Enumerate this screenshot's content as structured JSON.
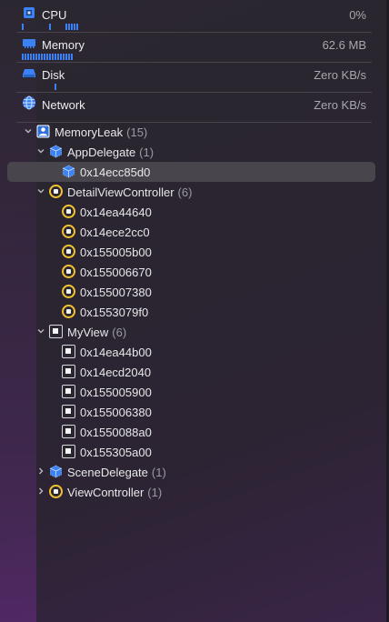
{
  "gauges": [
    {
      "label": "CPU",
      "value": "0%",
      "icon": "cpu-icon"
    },
    {
      "label": "Memory",
      "value": "62.6 MB",
      "icon": "memory-icon"
    },
    {
      "label": "Disk",
      "value": "Zero KB/s",
      "icon": "disk-icon"
    },
    {
      "label": "Network",
      "value": "Zero KB/s",
      "icon": "globe-icon"
    }
  ],
  "tree": {
    "root": {
      "label": "MemoryLeak",
      "count": "(15)"
    },
    "app_delegate": {
      "label": "AppDelegate",
      "count": "(1)",
      "instances": [
        "0x14ecc85d0"
      ]
    },
    "detail_vc": {
      "label": "DetailViewController",
      "count": "(6)",
      "instances": [
        "0x14ea44640",
        "0x14ece2cc0",
        "0x155005b00",
        "0x155006670",
        "0x155007380",
        "0x1553079f0"
      ]
    },
    "my_view": {
      "label": "MyView",
      "count": "(6)",
      "instances": [
        "0x14ea44b00",
        "0x14ecd2040",
        "0x155005900",
        "0x155006380",
        "0x1550088a0",
        "0x155305a00"
      ]
    },
    "scene_delegate": {
      "label": "SceneDelegate",
      "count": "(1)"
    },
    "view_controller": {
      "label": "ViewController",
      "count": "(1)"
    }
  },
  "colors": {
    "accent": "#3b82f6",
    "object_ring": "#f2c230",
    "selection": "#48454d"
  }
}
